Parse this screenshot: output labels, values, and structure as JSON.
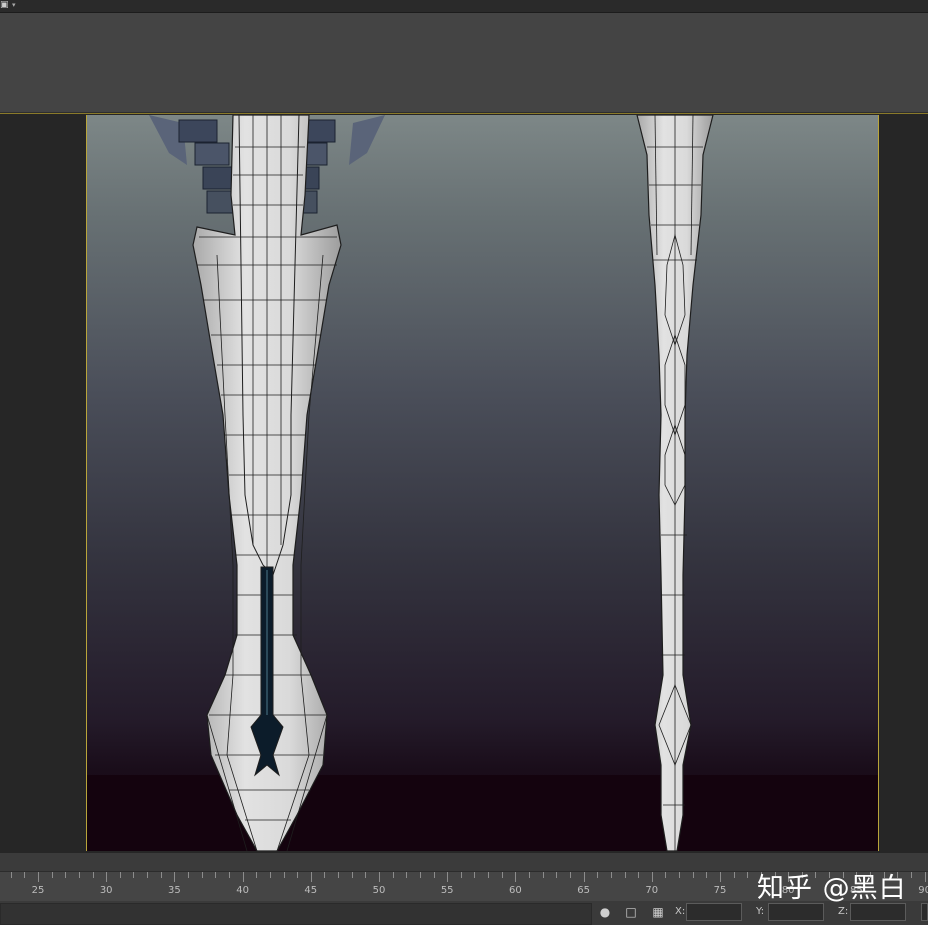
{
  "menubar": {
    "logo_icon": "app-logo-icon",
    "dropdown_icon": "chevron-down-icon"
  },
  "viewport": {
    "models": [
      "sword-front-view",
      "sword-side-view"
    ],
    "colors": {
      "border_active": "#b9a53a",
      "mesh": "#d8d8d8",
      "wire": "#1e1e1e",
      "groove": "#0c1c2a"
    }
  },
  "timeline": {
    "ruler_labels": [
      "25",
      "30",
      "35",
      "40",
      "45",
      "50",
      "55",
      "60",
      "65",
      "70",
      "75",
      "80",
      "85",
      "90"
    ]
  },
  "statusbar": {
    "icons": [
      "bulb-icon",
      "lock-icon",
      "selection-icon"
    ],
    "x_label": "X:",
    "y_label": "Y:",
    "z_label": "Z:",
    "x_value": "",
    "y_value": "",
    "z_value": ""
  },
  "watermark": {
    "text": "知乎 @黑白"
  }
}
